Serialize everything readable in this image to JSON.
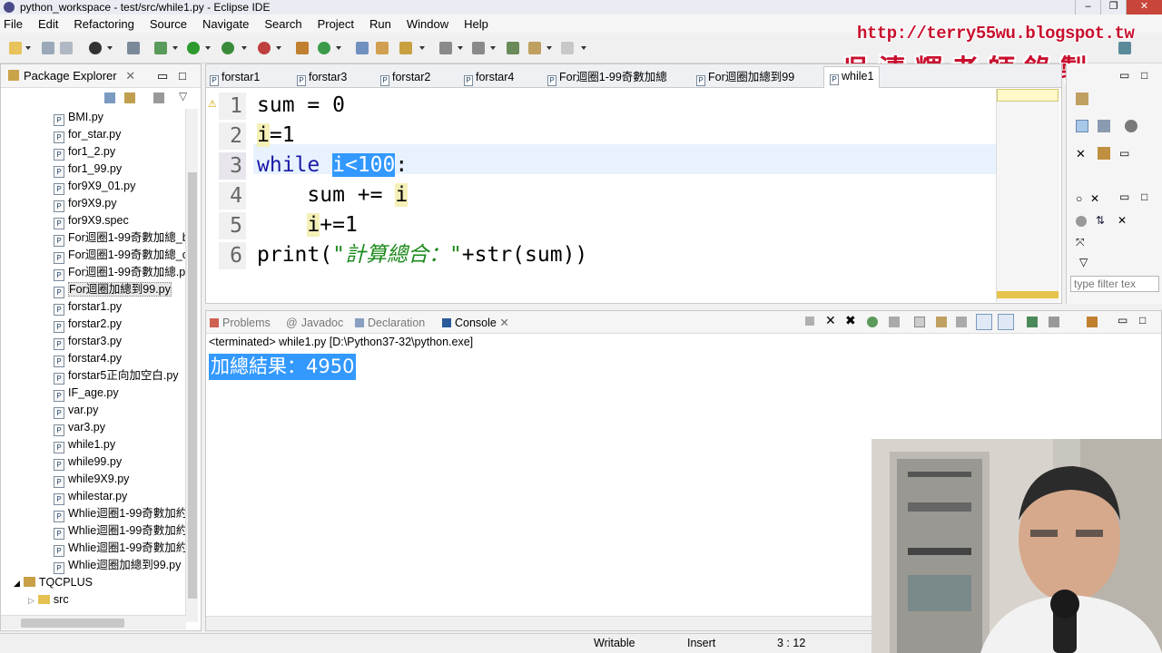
{
  "window": {
    "title": "python_workspace - test/src/while1.py - Eclipse IDE"
  },
  "menu": [
    "File",
    "Edit",
    "Refactoring",
    "Source",
    "Navigate",
    "Search",
    "Project",
    "Run",
    "Window",
    "Help"
  ],
  "watermark": {
    "url": "http://terry55wu.blogspot.tw",
    "name": "吳清輝老師錄製"
  },
  "package_explorer": {
    "title": "Package Explorer",
    "files": [
      "BMI.py",
      "for_star.py",
      "for1_2.py",
      "for1_99.py",
      "for9X9_01.py",
      "for9X9.py",
      "for9X9.spec",
      "For迴圈1-99奇數加總_b",
      "For迴圈1-99奇數加總_c",
      "For迴圈1-99奇數加總.p",
      "For迴圈加總到99.py",
      "forstar1.py",
      "forstar2.py",
      "forstar3.py",
      "forstar4.py",
      "forstar5正向加空白.py",
      "IF_age.py",
      "var.py",
      "var3.py",
      "while1.py",
      "while99.py",
      "while9X9.py",
      "whilestar.py",
      "Whlie迴圈1-99奇數加約",
      "Whlie迴圈1-99奇數加約",
      "Whlie迴圈1-99奇數加約",
      "Whlie迴圈加總到99.py"
    ],
    "selected_file": "For迴圈加總到99.py",
    "project": "TQCPLUS",
    "project_child": "src"
  },
  "editor": {
    "tabs": [
      "forstar1",
      "forstar3",
      "forstar2",
      "forstar4",
      "For迴圈1-99奇數加總",
      "For迴圈加總到99",
      "while1"
    ],
    "active_tab": "while1",
    "line_numbers": [
      "1",
      "2",
      "3",
      "4",
      "5",
      "6"
    ],
    "code": {
      "l1": "sum = 0",
      "l2_var": "i",
      "l2_rest": "=1",
      "l3_kw": "while",
      "l3_sel": "i<100",
      "l3_rest": ":",
      "l4_pre": "    sum += ",
      "l4_var": "i",
      "l5_var": "i",
      "l5_rest": "+=1",
      "l6_pre": "print(",
      "l6_str": "\"計算總合：\"",
      "l6_post": "+str(sum))"
    }
  },
  "outline": {
    "filter_placeholder": "type filter tex"
  },
  "console": {
    "tabs": [
      "Problems",
      "Javadoc",
      "Declaration",
      "Console"
    ],
    "active_tab": "Console",
    "status": "<terminated> while1.py [D:\\Python37-32\\python.exe]",
    "output": "加總結果：4950"
  },
  "statusbar": {
    "mode": "Writable",
    "insert": "Insert",
    "position": "3 : 12"
  },
  "colors": {
    "keyword": "#1a1aa6",
    "string": "#1b8a1b",
    "selection": "#3399ff",
    "watermark": "#c8102e"
  }
}
